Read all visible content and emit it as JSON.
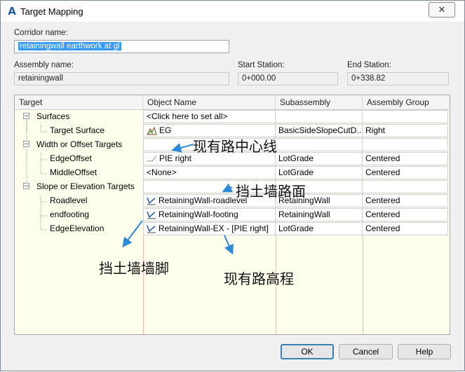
{
  "window": {
    "title": "Target Mapping",
    "close_label": "✕"
  },
  "corridor": {
    "label": "Corridor name:",
    "value": "retainingwall earthwork at gl"
  },
  "assembly": {
    "label": "Assembly name:",
    "value": "retainingwall"
  },
  "start_station": {
    "label": "Start Station:",
    "value": "0+000.00"
  },
  "end_station": {
    "label": "End Station:",
    "value": "0+338.82"
  },
  "table": {
    "headers": [
      "Target",
      "Object Name",
      "Subassembly",
      "Assembly Group"
    ],
    "rows": [
      {
        "target": "Surfaces",
        "group": true,
        "object": "<Click here to set all>",
        "subassembly": "",
        "assembly_group": ""
      },
      {
        "target": "Target Surface",
        "group": false,
        "object": "EG",
        "object_icon": "surface-icon",
        "subassembly": "BasicSideSlopeCutD...",
        "assembly_group": "Right"
      },
      {
        "target": "Width or Offset Targets",
        "group": true,
        "object": "",
        "subassembly": "",
        "assembly_group": ""
      },
      {
        "target": "EdgeOffset",
        "group": false,
        "object": "PIE right",
        "object_icon": "alignment-icon",
        "subassembly": "LotGrade",
        "assembly_group": "Centered"
      },
      {
        "target": "MiddleOffset",
        "group": false,
        "object": "<None>",
        "subassembly": "LotGrade",
        "assembly_group": "Centered"
      },
      {
        "target": "Slope or Elevation Targets",
        "group": true,
        "object": "",
        "subassembly": "",
        "assembly_group": ""
      },
      {
        "target": "Roadlevel",
        "group": false,
        "object": "RetainingWall-roadlevel",
        "object_icon": "profile-icon",
        "subassembly": "RetainingWall",
        "assembly_group": "Centered"
      },
      {
        "target": "endfooting",
        "group": false,
        "object": "RetainingWall-footing",
        "object_icon": "profile-icon",
        "subassembly": "RetainingWall",
        "assembly_group": "Centered"
      },
      {
        "target": "EdgeElevation",
        "group": false,
        "object": "RetainingWall-EX - [PIE right]",
        "object_icon": "profile-icon",
        "subassembly": "LotGrade",
        "assembly_group": "Centered"
      }
    ]
  },
  "annotations": [
    "现有路中心线",
    "挡土墙路面",
    "挡土墙墙脚",
    "现有路高程"
  ],
  "buttons": {
    "ok": "OK",
    "cancel": "Cancel",
    "help": "Help"
  },
  "colors": {
    "grid_background": "#ffffee",
    "arrow": "#2e8ad8",
    "selection": "#3399ff"
  }
}
